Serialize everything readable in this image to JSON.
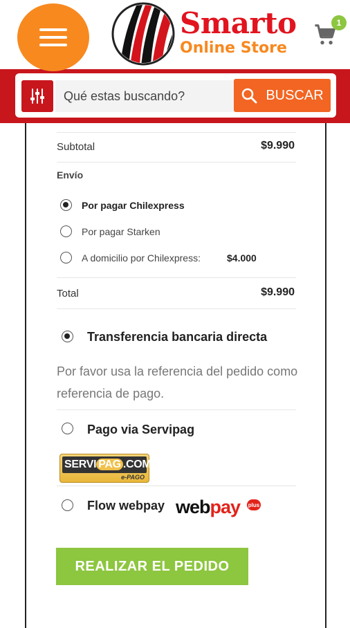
{
  "header": {
    "logo_title": "Smarto",
    "logo_subtitle": "Online Store",
    "cart_count": "1"
  },
  "search": {
    "placeholder": "Qué estas buscando?",
    "button_label": "BUSCAR"
  },
  "summary": {
    "subtotal_label": "Subtotal",
    "subtotal_value": "$9.990",
    "shipping_label": "Envío",
    "shipping_options": [
      {
        "label": "Por pagar Chilexpress",
        "selected": true
      },
      {
        "label": "Por pagar Starken",
        "selected": false
      },
      {
        "label": "A domicilio por Chilexpress:",
        "price": "$4.000",
        "selected": false
      }
    ],
    "total_label": "Total",
    "total_value": "$9.990"
  },
  "payment": {
    "methods": [
      {
        "label": "Transferencia bancaria directa",
        "selected": true
      },
      {
        "label": "Pago via Servipag",
        "selected": false
      },
      {
        "label": "Flow webpay",
        "selected": false
      }
    ],
    "transfer_note": "Por favor usa la referencia del pedido como referencia de pago.",
    "servipag_logo": "SERVIPAG.COM e-PAGO",
    "webpay_logo": "webpay plus"
  },
  "order_button": "REALIZAR EL PEDIDO",
  "colors": {
    "brand_red": "#c8161d",
    "brand_orange": "#f7891f",
    "search_button": "#f26522",
    "order_green": "#8dc63f"
  }
}
